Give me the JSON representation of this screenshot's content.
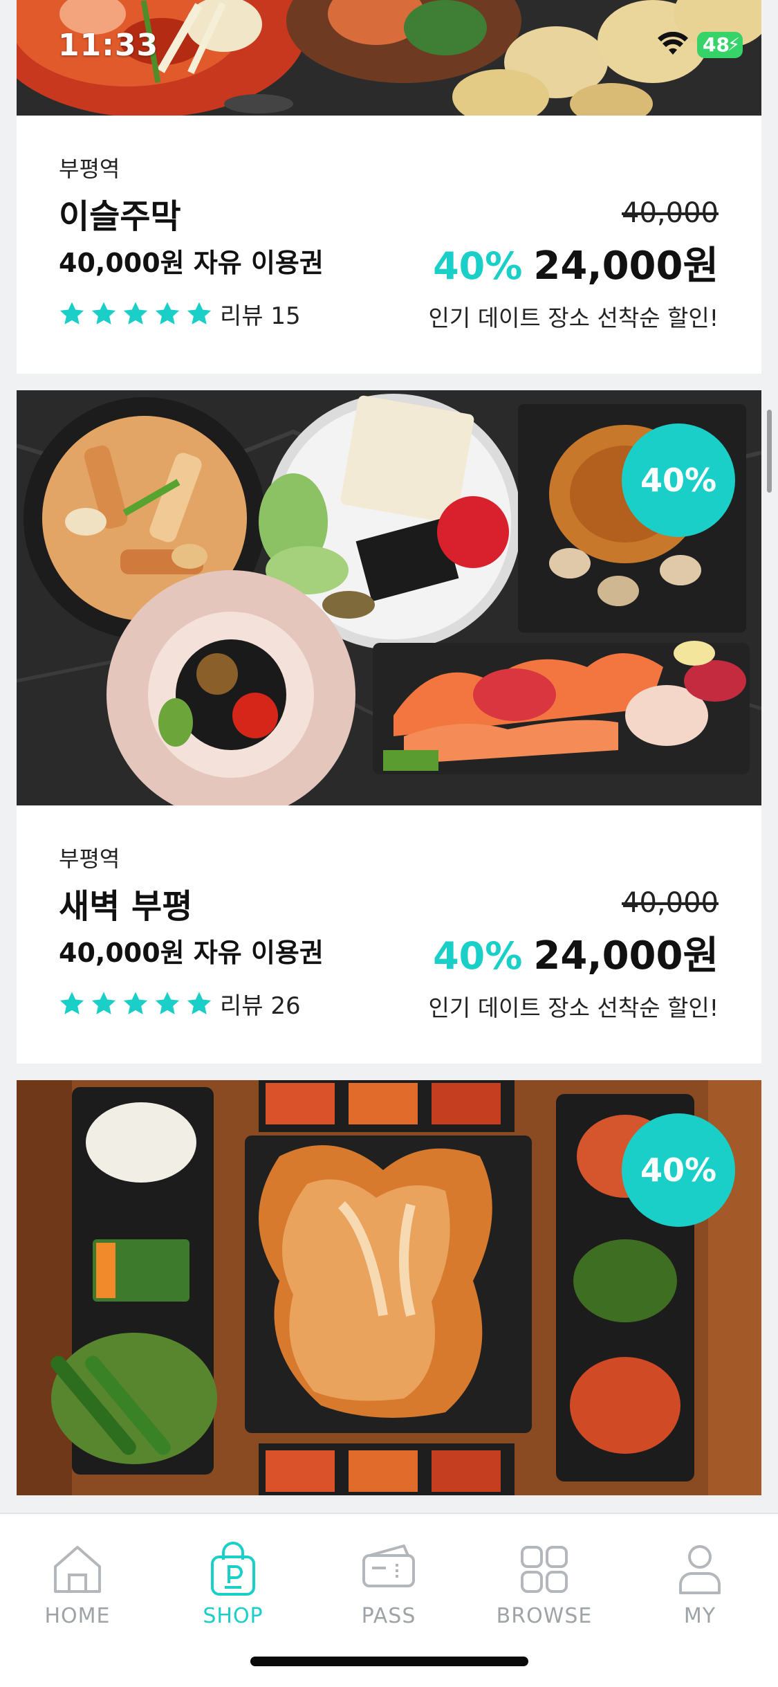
{
  "status_bar": {
    "time": "11:33",
    "battery": "48",
    "battery_icon": "charging-bolt",
    "wifi_icon": "wifi-icon"
  },
  "colors": {
    "accent": "#1bcfc9",
    "inactive_tab": "#9ea3a7",
    "card_bg": "#ffffff",
    "page_bg": "#f0f1f2"
  },
  "products": [
    {
      "location": "부평역",
      "name": "이슬주막",
      "ticket": "40,000원 자유 이용권",
      "original_price": "40,000",
      "discount_rate": "40%",
      "sale_price": "24,000원",
      "rating": 5,
      "review_label": "리뷰 15",
      "promo": "인기 데이트 장소 선착순 할인!"
    },
    {
      "location": "부평역",
      "name": "새벽 부평",
      "ticket": "40,000원 자유 이용권",
      "original_price": "40,000",
      "discount_rate": "40%",
      "sale_price": "24,000원",
      "rating": 5,
      "review_label": "리뷰 26",
      "promo": "인기 데이트 장소 선착순 할인!",
      "badge": "40%"
    },
    {
      "badge": "40%"
    }
  ],
  "tab_bar": {
    "active": "SHOP",
    "tabs": [
      {
        "label": "HOME",
        "icon": "home-icon"
      },
      {
        "label": "SHOP",
        "icon": "shopping-bag-icon"
      },
      {
        "label": "PASS",
        "icon": "ticket-icon"
      },
      {
        "label": "BROWSE",
        "icon": "grid-icon"
      },
      {
        "label": "MY",
        "icon": "person-icon"
      }
    ]
  }
}
